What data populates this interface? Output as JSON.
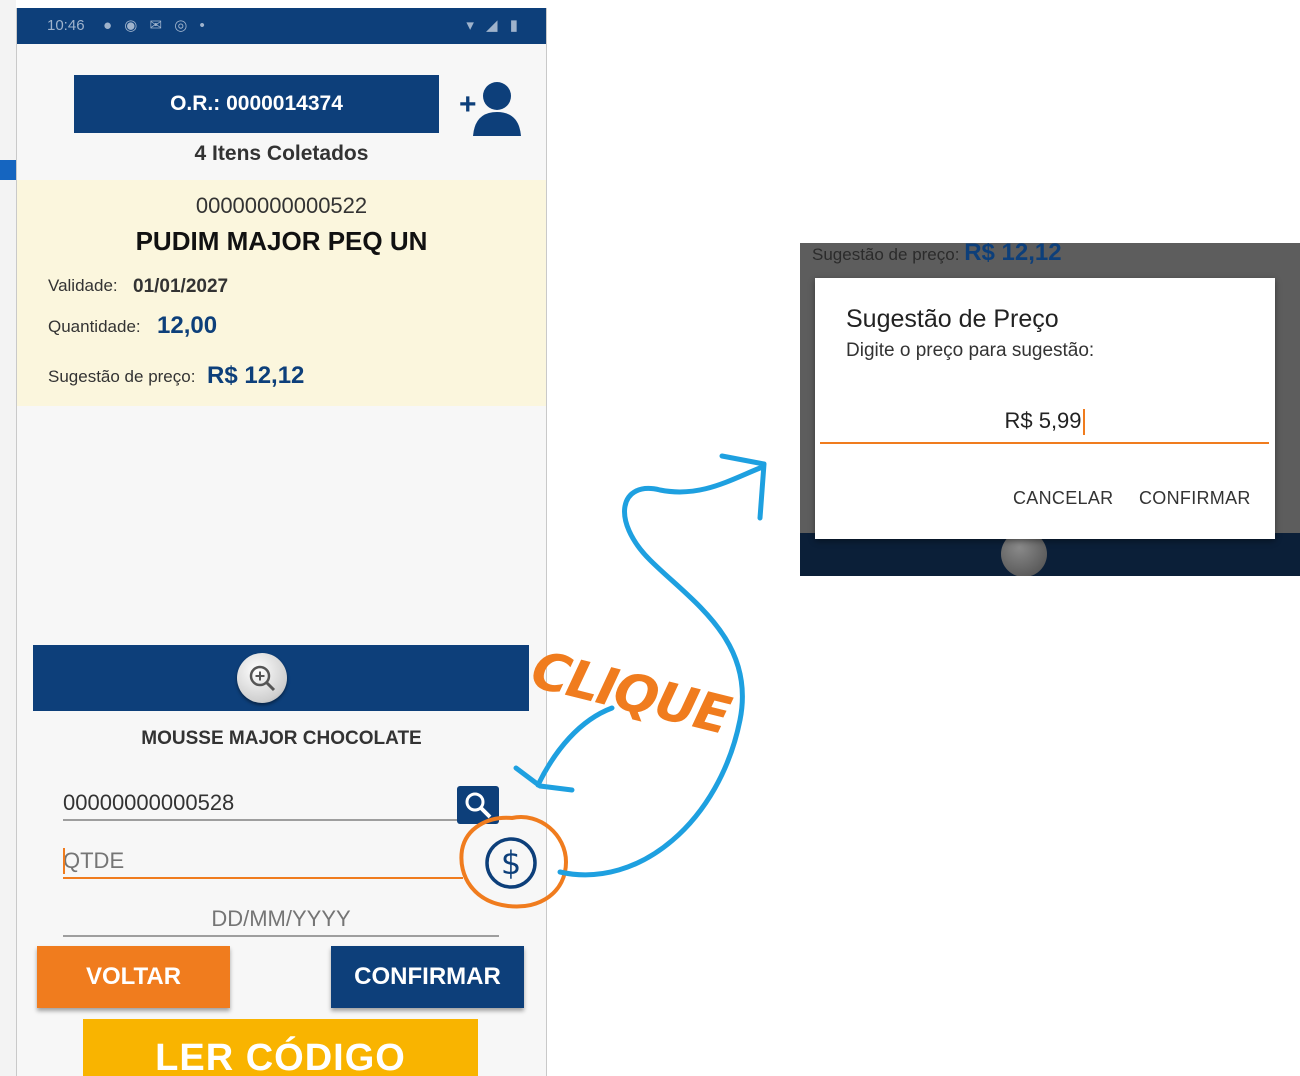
{
  "phone": {
    "order_label": "O.R.: 0000014374",
    "items_collected": "4 Itens Coletados",
    "item": {
      "code": "00000000000522",
      "name": "PUDIM MAJOR PEQ UN",
      "validity_label": "Validade:",
      "validity_value": "01/01/2027",
      "quantity_label": "Quantidade:",
      "quantity_value": "12,00",
      "price_label": "Sugestão de preço:",
      "price_value": "R$ 12,12"
    },
    "current_product": "MOUSSE MAJOR CHOCOLATE",
    "code_input_value": "00000000000528",
    "qty_placeholder": "QTDE",
    "date_placeholder": "DD/MM/YYYY",
    "voltar_label": "VOLTAR",
    "confirmar_label": "CONFIRMAR",
    "ler_codigo_label": "LER CÓDIGO",
    "status_time": "10:46"
  },
  "dialog_shot": {
    "bg_price_label": "Sugestão de preço:",
    "bg_price_value": "R$ 12,12",
    "title": "Sugestão de Preço",
    "subtitle": "Digite o preço para sugestão:",
    "input_value": "R$ 5,99",
    "cancel_label": "CANCELAR",
    "confirm_label": "CONFIRMAR"
  },
  "annotation": {
    "text": "CLIQUE"
  },
  "colors": {
    "primary": "#0d3f7a",
    "accent": "#f07c1e",
    "yellow": "#f9b400",
    "card": "#fbf6dd",
    "annotation_blue": "#1ea0e0"
  },
  "icons": [
    "add-user-icon",
    "zoom-in-icon",
    "search-icon",
    "dollar-icon"
  ]
}
